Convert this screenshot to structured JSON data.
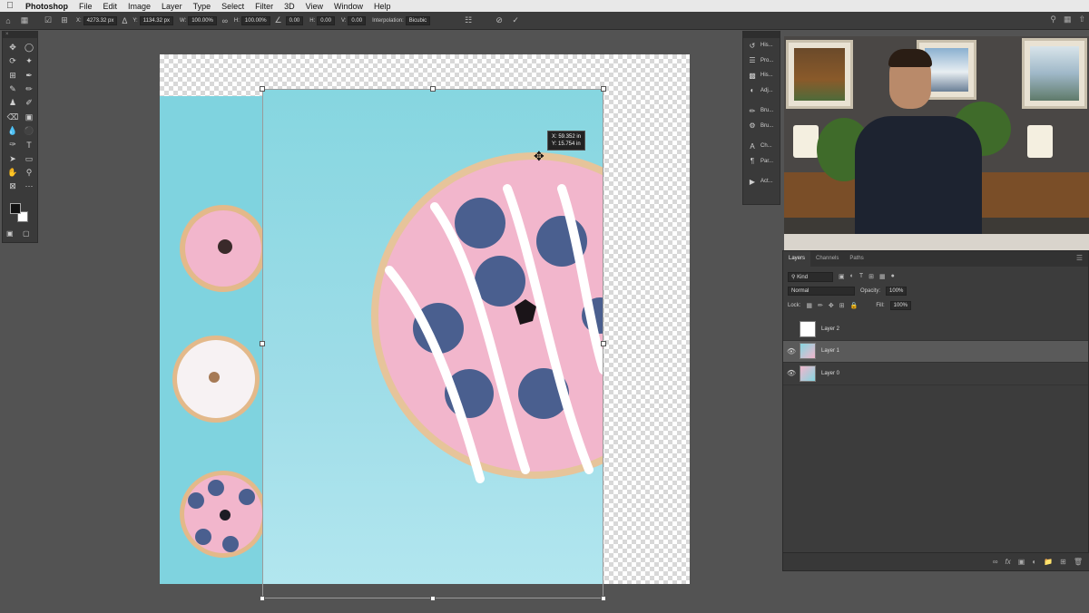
{
  "menubar": {
    "apple_icon": "apple-logo-icon",
    "app_name": "Photoshop",
    "items": [
      "File",
      "Edit",
      "Image",
      "Layer",
      "Type",
      "Select",
      "Filter",
      "3D",
      "View",
      "Window",
      "Help"
    ]
  },
  "options_bar": {
    "x_label": "X:",
    "x_value": "4273.32 px",
    "y_label": "Y:",
    "y_value": "1134.32 px",
    "w_label": "W:",
    "w_value": "100.00%",
    "h_label": "H:",
    "h_value": "100.00%",
    "angle_value": "0.00",
    "hskew_label": "H:",
    "hskew_value": "0.00",
    "vskew_label": "V:",
    "vskew_value": "0.00",
    "interp_label": "Interpolation:",
    "interp_value": "Bicubic",
    "cancel_icon": "cancel-transform-icon",
    "commit_icon": "commit-transform-icon"
  },
  "canvas": {
    "coord_x": "X: 59.352 in",
    "coord_y": "Y: 15.754 in"
  },
  "dock": {
    "items": [
      {
        "icon": "history-icon",
        "label": "His..."
      },
      {
        "icon": "properties-icon",
        "label": "Pro..."
      },
      {
        "icon": "histogram-icon",
        "label": "His..."
      },
      {
        "icon": "adjustments-icon",
        "label": "Adj..."
      },
      {
        "icon": "brush-icon",
        "label": "Bru..."
      },
      {
        "icon": "brush-settings-icon",
        "label": "Bru..."
      },
      {
        "icon": "character-icon",
        "label": "Ch..."
      },
      {
        "icon": "paragraph-icon",
        "label": "Par..."
      },
      {
        "icon": "actions-icon",
        "label": "Act..."
      }
    ]
  },
  "layers_panel": {
    "tabs": [
      "Layers",
      "Channels",
      "Paths"
    ],
    "kind_filter": "Kind",
    "blend_mode": "Normal",
    "opacity_label": "Opacity:",
    "opacity_value": "100%",
    "lock_label": "Lock:",
    "fill_label": "Fill:",
    "fill_value": "100%",
    "layers": [
      {
        "name": "Layer 2",
        "visible": false,
        "selected": false
      },
      {
        "name": "Layer 1",
        "visible": true,
        "selected": true
      },
      {
        "name": "Layer 0",
        "visible": true,
        "selected": false
      }
    ]
  },
  "colors": {
    "accent_cyan": "#86d6e0",
    "donut_pink": "#f2b6cc",
    "blueberry": "#4a5f8f"
  }
}
